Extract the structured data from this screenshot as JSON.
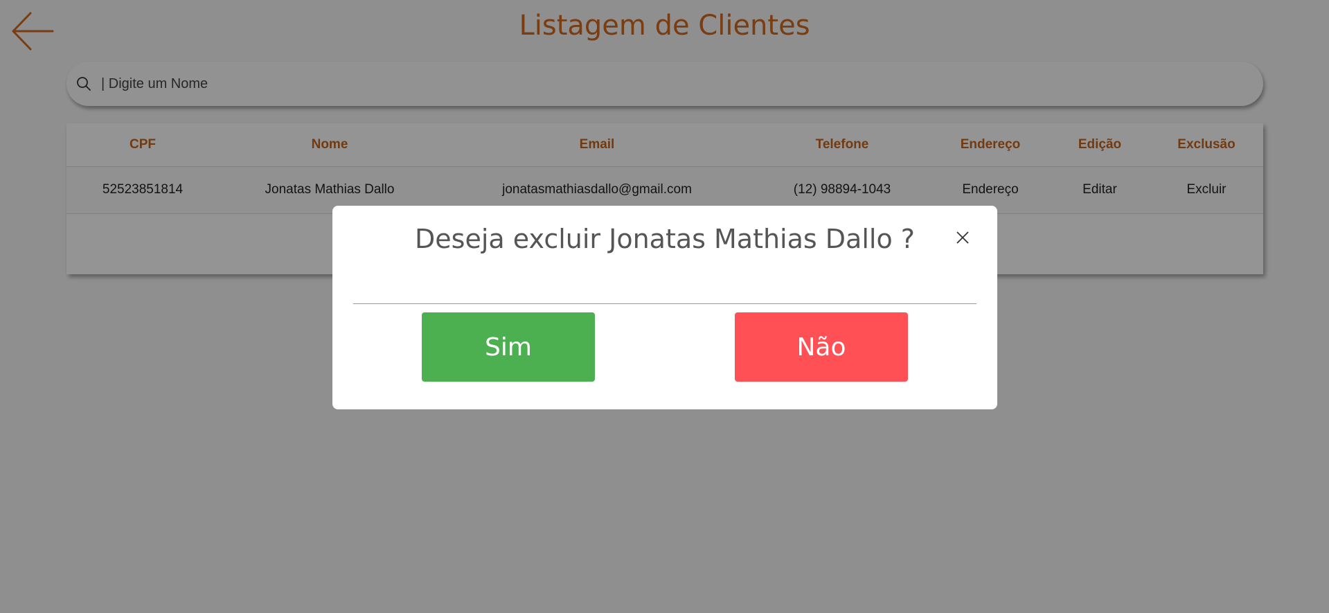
{
  "header": {
    "title": "Listagem de Clientes",
    "back_icon": "arrow-left-icon"
  },
  "search": {
    "placeholder": "| Digite um Nome",
    "icon": "search-icon"
  },
  "table": {
    "columns": [
      "CPF",
      "Nome",
      "Email",
      "Telefone",
      "Endereço",
      "Edição",
      "Exclusão"
    ],
    "rows": [
      {
        "cpf": "52523851814",
        "nome": "Jonatas Mathias Dallo",
        "email": "jonatasmathiasdallo@gmail.com",
        "telefone": "(12) 98894-1043",
        "endereco": "Endereço",
        "edicao": "Editar",
        "exclusao": "Excluir"
      }
    ]
  },
  "modal": {
    "title": "Deseja excluir Jonatas Mathias Dallo ?",
    "yes_label": "Sim",
    "no_label": "Não"
  },
  "colors": {
    "accent": "#d3691e",
    "header_text": "#c5651c",
    "yes": "#4caf50",
    "no": "#ff5055",
    "overlay": "rgba(0,0,0,0.42)"
  }
}
